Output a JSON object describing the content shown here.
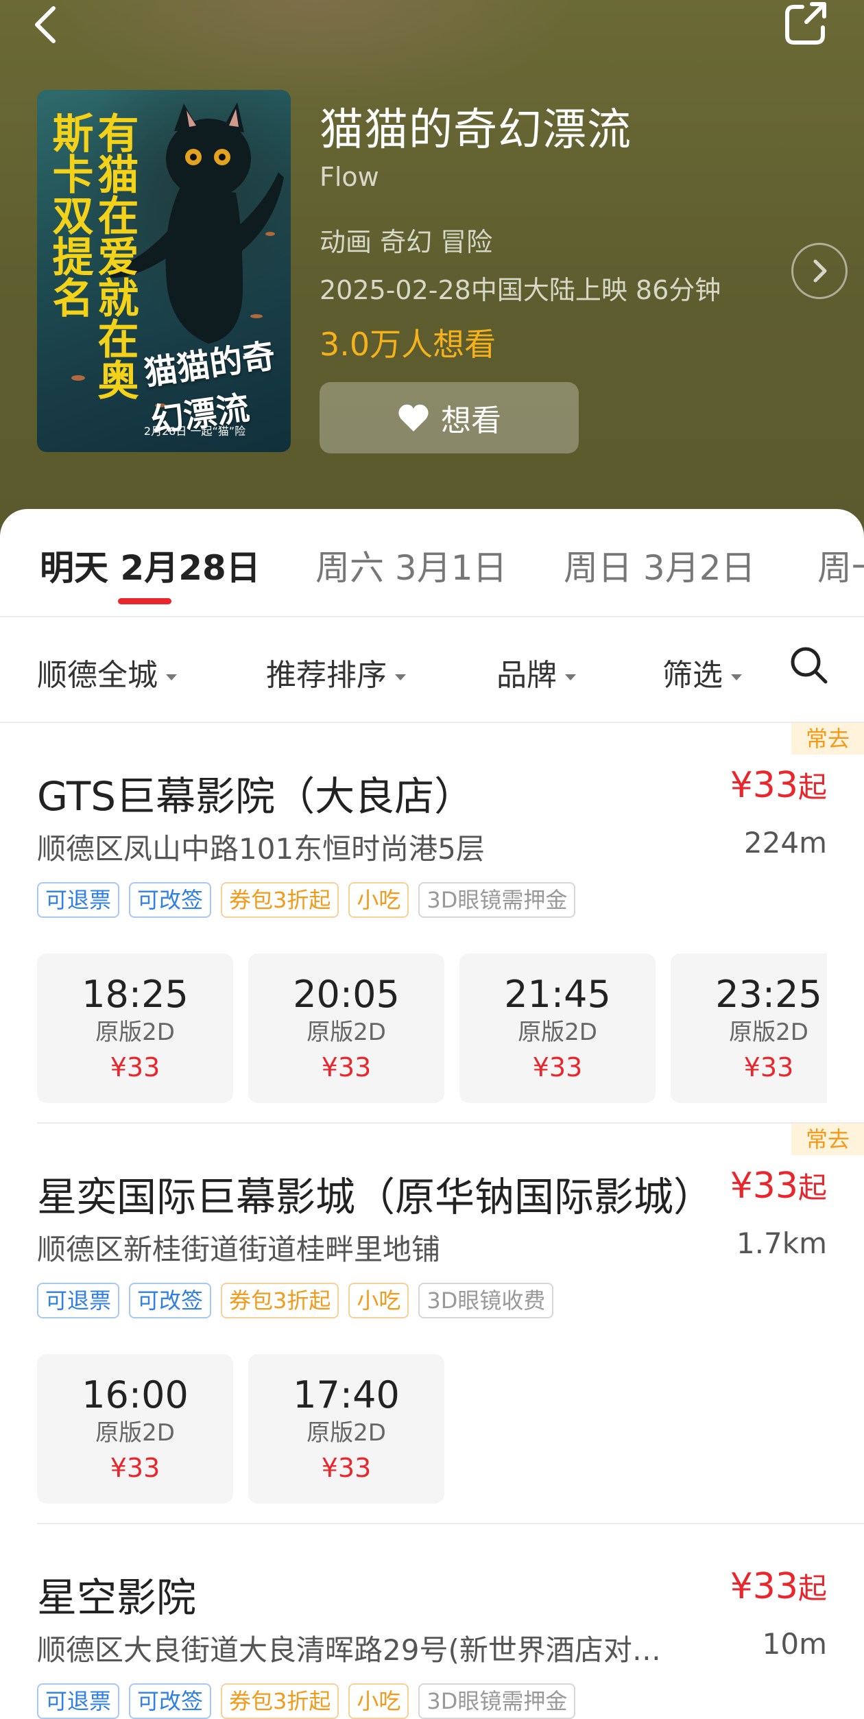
{
  "header": {
    "back_icon": "chevron-left-icon",
    "share_icon": "share-icon"
  },
  "movie": {
    "title": "猫猫的奇幻漂流",
    "title_en": "Flow",
    "genres": "动画 奇幻 冒险",
    "release": "2025-02-28中国大陆上映 86分钟",
    "want_count": "3.0万人想看",
    "want_button": "想看",
    "poster": {
      "slogan": "有猫在爱就在奥斯卡双提名",
      "title": "猫猫的奇幻漂流",
      "date_line": "2月28日 一起“猫”险"
    }
  },
  "date_tabs": [
    {
      "label": "明天 2月28日",
      "active": true
    },
    {
      "label": "周六 3月1日",
      "active": false
    },
    {
      "label": "周日 3月2日",
      "active": false
    },
    {
      "label": "周一",
      "active": false
    }
  ],
  "filters": {
    "area": "顺德全城",
    "sort": "推荐排序",
    "brand": "品牌",
    "filter": "筛选"
  },
  "cinemas": [
    {
      "badge": "常去",
      "name": "GTS巨幕影院（大良店）",
      "price": "¥33",
      "price_suffix": "起",
      "address": "顺德区凤山中路101东恒时尚港5层",
      "distance": "224m",
      "tags": [
        "可退票",
        "可改签",
        "券包3折起",
        "小吃",
        "3D眼镜需押金"
      ],
      "showtimes": [
        {
          "time": "18:25",
          "version": "原版2D",
          "price": "¥33"
        },
        {
          "time": "20:05",
          "version": "原版2D",
          "price": "¥33"
        },
        {
          "time": "21:45",
          "version": "原版2D",
          "price": "¥33"
        },
        {
          "time": "23:25",
          "version": "原版2D",
          "price": "¥33"
        }
      ]
    },
    {
      "badge": "常去",
      "name": "星奕国际巨幕影城（原华钠国际影城）",
      "price": "¥33",
      "price_suffix": "起",
      "address": "顺德区新桂街道街道桂畔里地铺",
      "distance": "1.7km",
      "tags": [
        "可退票",
        "可改签",
        "券包3折起",
        "小吃",
        "3D眼镜收费"
      ],
      "showtimes": [
        {
          "time": "16:00",
          "version": "原版2D",
          "price": "¥33"
        },
        {
          "time": "17:40",
          "version": "原版2D",
          "price": "¥33"
        }
      ]
    },
    {
      "name": "星空影院",
      "price": "¥33",
      "price_suffix": "起",
      "address": "顺德区大良街道大良清晖路29号(新世界酒店对…",
      "distance": "10m",
      "tags": [
        "可退票",
        "可改签",
        "券包3折起",
        "小吃",
        "3D眼镜需押金"
      ]
    }
  ],
  "colors": {
    "accent_red": "#e8262c",
    "want_orange": "#f6b21c",
    "tag_blue": "#2f7fe6",
    "tag_orange": "#f39a1a",
    "header_bg": "#5e5d2f"
  }
}
